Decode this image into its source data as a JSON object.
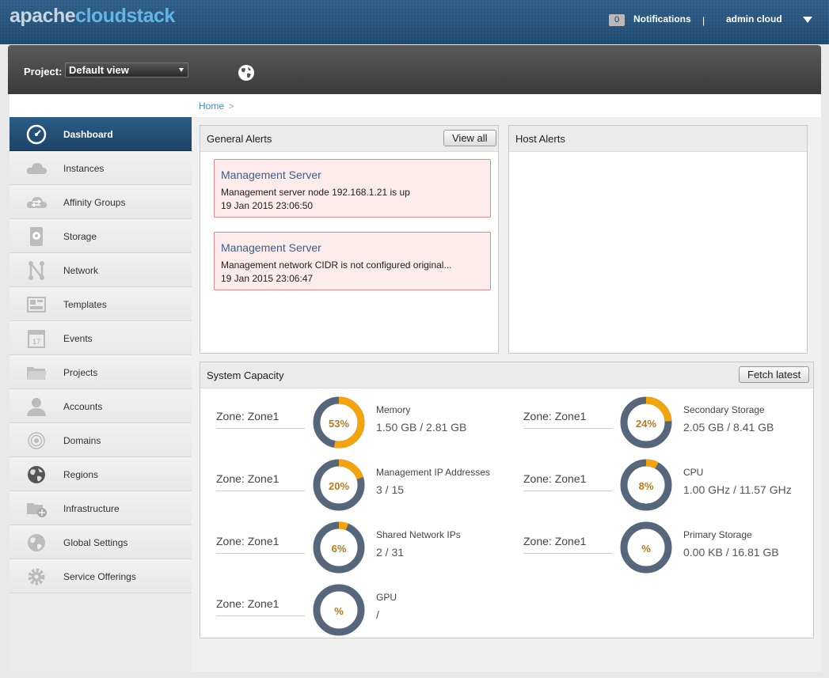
{
  "header": {
    "logo_part1": "apache",
    "logo_part2": "cloudstack",
    "notification_count": "0",
    "notifications_label": "Notifications",
    "separator": "|",
    "user_name": "admin cloud"
  },
  "project": {
    "label": "Project:",
    "selected": "Default view"
  },
  "sidebar": {
    "items": [
      {
        "label": "Dashboard",
        "icon": "dashboard-icon"
      },
      {
        "label": "Instances",
        "icon": "cloud-icon"
      },
      {
        "label": "Affinity Groups",
        "icon": "affinity-icon"
      },
      {
        "label": "Storage",
        "icon": "storage-icon"
      },
      {
        "label": "Network",
        "icon": "network-icon"
      },
      {
        "label": "Templates",
        "icon": "templates-icon"
      },
      {
        "label": "Events",
        "icon": "calendar-icon"
      },
      {
        "label": "Projects",
        "icon": "folder-icon"
      },
      {
        "label": "Accounts",
        "icon": "user-icon"
      },
      {
        "label": "Domains",
        "icon": "domains-icon"
      },
      {
        "label": "Regions",
        "icon": "globe-icon"
      },
      {
        "label": "Infrastructure",
        "icon": "infrastructure-icon"
      },
      {
        "label": "Global Settings",
        "icon": "global-settings-icon"
      },
      {
        "label": "Service Offerings",
        "icon": "gear-icon"
      }
    ],
    "calendar_day": "17"
  },
  "breadcrumb": {
    "home": "Home",
    "sep": ">"
  },
  "general_alerts": {
    "title": "General Alerts",
    "view_all": "View all",
    "alerts": [
      {
        "title": "Management Server",
        "message": "Management server node 192.168.1.21 is up",
        "date": "19 Jan 2015 23:06:50"
      },
      {
        "title": "Management Server",
        "message": "Management network CIDR is not configured original...",
        "date": "19 Jan 2015 23:06:47"
      }
    ]
  },
  "host_alerts": {
    "title": "Host Alerts"
  },
  "system_capacity": {
    "title": "System Capacity",
    "fetch_latest": "Fetch latest",
    "items": [
      {
        "zone": "Zone: Zone1",
        "percent_label": "53%",
        "fraction": 0.53,
        "name": "Memory",
        "value": "1.50 GB / 2.81 GB"
      },
      {
        "zone": "Zone: Zone1",
        "percent_label": "24%",
        "fraction": 0.24,
        "name": "Secondary Storage",
        "value": "2.05 GB / 8.41 GB"
      },
      {
        "zone": "Zone: Zone1",
        "percent_label": "20%",
        "fraction": 0.2,
        "name": "Management IP Addresses",
        "value": "3 / 15"
      },
      {
        "zone": "Zone: Zone1",
        "percent_label": "8%",
        "fraction": 0.08,
        "name": "CPU",
        "value": "1.00 GHz / 11.57 GHz"
      },
      {
        "zone": "Zone: Zone1",
        "percent_label": "6%",
        "fraction": 0.06,
        "name": "Shared Network IPs",
        "value": "2 / 31"
      },
      {
        "zone": "Zone: Zone1",
        "percent_label": "%",
        "fraction": 0,
        "name": "Primary Storage",
        "value": "0.00 KB / 16.81 GB"
      },
      {
        "zone": "Zone: Zone1",
        "percent_label": "%",
        "fraction": 0,
        "name": "GPU",
        "value": "/"
      }
    ]
  },
  "colors": {
    "ring_fill": "#f3a40c",
    "ring_track": "#56677c",
    "accent": "#2a5d86"
  }
}
